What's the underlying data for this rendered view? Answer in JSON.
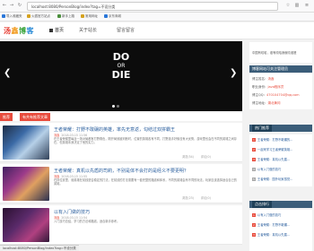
{
  "browser": {
    "url": "localhost:8080/PersonBlog/index?tag=不设分类",
    "bookmarks": [
      "导入收藏夹",
      "火狐官方站点",
      "新手上路",
      "常用网址",
      "京东商城"
    ]
  },
  "site": {
    "logo_chars": [
      "汤",
      "鑫",
      "博",
      "客"
    ],
    "nav": [
      "首页",
      "关于站长",
      "留言留言"
    ]
  },
  "hero": {
    "line1": "DO",
    "line2": "OR",
    "line3": "DIE",
    "prev": "❮",
    "next": "❯"
  },
  "recommend": {
    "badge": "推荐",
    "text": "有共有推荐文章"
  },
  "articles": [
    {
      "title": "王者荣耀：打野不敢碾的英雄，率先无意返，勾结过双拼霸王",
      "author": "汤鑫",
      "date": "2018-03-15 11:56",
      "desc": "在王者荣耀里每逢一场对局都有打野角色，刚开局就被判断时，位置的英雄各有不同，打野选手好像没有大优势，游戏里也会在不同的英雄之间存在，但英雄本身决定了他的实力。",
      "views": "浏览(54)",
      "likes": "评论(0)"
    },
    {
      "title": "王者荣耀：真机以先盾的司莉，不别是体不会打的是经义不要更明？",
      "author": "汤鑫",
      "date": "2018-03-15 11:55",
      "desc": "在排位赛里，谁英雄在前线是否稳定的打法，在前线的打法需要有一套完整的路线和体系，不同的英雄会有不同的玩法，玩家应该选择适合自己的英雄。",
      "views": "浏览(23)",
      "likes": "评论(0)"
    },
    {
      "title": "以有入门做的技巧",
      "author": "汤鑫",
      "date": "2018-03-15 11:54",
      "desc": "入门技巧总结，学习的方法和路线，适合新手参考。",
      "views": "",
      "likes": ""
    }
  ],
  "sidebar": {
    "notice": "中国有嘻哈，谁有嘻哈我就嘻谁爸",
    "contact_head": "博客网站可关注管理员",
    "contact": [
      {
        "label": "博主姓名：",
        "value": "汤鑫"
      },
      {
        "label": "职业身份：",
        "value": "Java程序员"
      },
      {
        "label": "博主QQ：",
        "value": "470104704@qq.com"
      },
      {
        "label": "博主地址：",
        "value": "湖北黄冈"
      }
    ],
    "tags_head": "热门推荐",
    "tags": [
      {
        "n": "1",
        "text": "王者荣耀：打野不敢碾的..."
      },
      {
        "n": "2",
        "text": "一起来学习王者荣耀英雄..."
      },
      {
        "n": "3",
        "text": "王者荣耀：真机以先盾..."
      },
      {
        "n": "4",
        "text": "以有入门做的技巧"
      },
      {
        "n": "5",
        "text": "王者荣耀：国外玩家感觉..."
      }
    ],
    "hot_head": "点击排行",
    "hot": [
      {
        "n": "1",
        "text": "以有入门做的技巧"
      },
      {
        "n": "2",
        "text": "王者荣耀：打野不敢碾..."
      },
      {
        "n": "3",
        "text": "王者荣耀：真机以先盾..."
      }
    ]
  },
  "statusbar": "localhost:8080/PersonBlog/index?tag=不设分类"
}
